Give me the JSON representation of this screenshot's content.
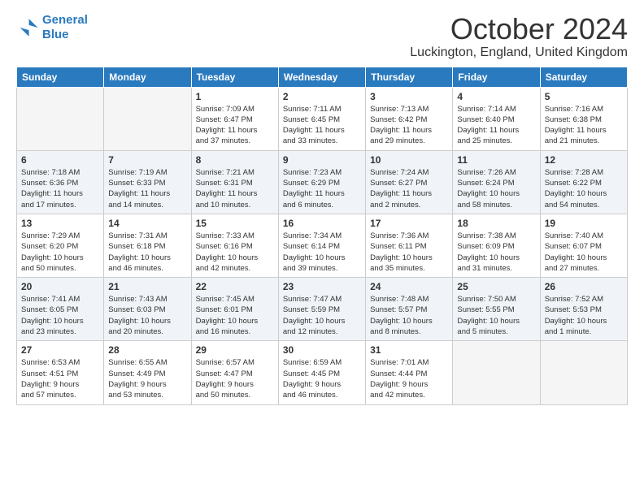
{
  "logo": {
    "line1": "General",
    "line2": "Blue"
  },
  "title": "October 2024",
  "location": "Luckington, England, United Kingdom",
  "days_of_week": [
    "Sunday",
    "Monday",
    "Tuesday",
    "Wednesday",
    "Thursday",
    "Friday",
    "Saturday"
  ],
  "weeks": [
    [
      {
        "num": "",
        "info": ""
      },
      {
        "num": "",
        "info": ""
      },
      {
        "num": "1",
        "info": "Sunrise: 7:09 AM\nSunset: 6:47 PM\nDaylight: 11 hours\nand 37 minutes."
      },
      {
        "num": "2",
        "info": "Sunrise: 7:11 AM\nSunset: 6:45 PM\nDaylight: 11 hours\nand 33 minutes."
      },
      {
        "num": "3",
        "info": "Sunrise: 7:13 AM\nSunset: 6:42 PM\nDaylight: 11 hours\nand 29 minutes."
      },
      {
        "num": "4",
        "info": "Sunrise: 7:14 AM\nSunset: 6:40 PM\nDaylight: 11 hours\nand 25 minutes."
      },
      {
        "num": "5",
        "info": "Sunrise: 7:16 AM\nSunset: 6:38 PM\nDaylight: 11 hours\nand 21 minutes."
      }
    ],
    [
      {
        "num": "6",
        "info": "Sunrise: 7:18 AM\nSunset: 6:36 PM\nDaylight: 11 hours\nand 17 minutes."
      },
      {
        "num": "7",
        "info": "Sunrise: 7:19 AM\nSunset: 6:33 PM\nDaylight: 11 hours\nand 14 minutes."
      },
      {
        "num": "8",
        "info": "Sunrise: 7:21 AM\nSunset: 6:31 PM\nDaylight: 11 hours\nand 10 minutes."
      },
      {
        "num": "9",
        "info": "Sunrise: 7:23 AM\nSunset: 6:29 PM\nDaylight: 11 hours\nand 6 minutes."
      },
      {
        "num": "10",
        "info": "Sunrise: 7:24 AM\nSunset: 6:27 PM\nDaylight: 11 hours\nand 2 minutes."
      },
      {
        "num": "11",
        "info": "Sunrise: 7:26 AM\nSunset: 6:24 PM\nDaylight: 10 hours\nand 58 minutes."
      },
      {
        "num": "12",
        "info": "Sunrise: 7:28 AM\nSunset: 6:22 PM\nDaylight: 10 hours\nand 54 minutes."
      }
    ],
    [
      {
        "num": "13",
        "info": "Sunrise: 7:29 AM\nSunset: 6:20 PM\nDaylight: 10 hours\nand 50 minutes."
      },
      {
        "num": "14",
        "info": "Sunrise: 7:31 AM\nSunset: 6:18 PM\nDaylight: 10 hours\nand 46 minutes."
      },
      {
        "num": "15",
        "info": "Sunrise: 7:33 AM\nSunset: 6:16 PM\nDaylight: 10 hours\nand 42 minutes."
      },
      {
        "num": "16",
        "info": "Sunrise: 7:34 AM\nSunset: 6:14 PM\nDaylight: 10 hours\nand 39 minutes."
      },
      {
        "num": "17",
        "info": "Sunrise: 7:36 AM\nSunset: 6:11 PM\nDaylight: 10 hours\nand 35 minutes."
      },
      {
        "num": "18",
        "info": "Sunrise: 7:38 AM\nSunset: 6:09 PM\nDaylight: 10 hours\nand 31 minutes."
      },
      {
        "num": "19",
        "info": "Sunrise: 7:40 AM\nSunset: 6:07 PM\nDaylight: 10 hours\nand 27 minutes."
      }
    ],
    [
      {
        "num": "20",
        "info": "Sunrise: 7:41 AM\nSunset: 6:05 PM\nDaylight: 10 hours\nand 23 minutes."
      },
      {
        "num": "21",
        "info": "Sunrise: 7:43 AM\nSunset: 6:03 PM\nDaylight: 10 hours\nand 20 minutes."
      },
      {
        "num": "22",
        "info": "Sunrise: 7:45 AM\nSunset: 6:01 PM\nDaylight: 10 hours\nand 16 minutes."
      },
      {
        "num": "23",
        "info": "Sunrise: 7:47 AM\nSunset: 5:59 PM\nDaylight: 10 hours\nand 12 minutes."
      },
      {
        "num": "24",
        "info": "Sunrise: 7:48 AM\nSunset: 5:57 PM\nDaylight: 10 hours\nand 8 minutes."
      },
      {
        "num": "25",
        "info": "Sunrise: 7:50 AM\nSunset: 5:55 PM\nDaylight: 10 hours\nand 5 minutes."
      },
      {
        "num": "26",
        "info": "Sunrise: 7:52 AM\nSunset: 5:53 PM\nDaylight: 10 hours\nand 1 minute."
      }
    ],
    [
      {
        "num": "27",
        "info": "Sunrise: 6:53 AM\nSunset: 4:51 PM\nDaylight: 9 hours\nand 57 minutes."
      },
      {
        "num": "28",
        "info": "Sunrise: 6:55 AM\nSunset: 4:49 PM\nDaylight: 9 hours\nand 53 minutes."
      },
      {
        "num": "29",
        "info": "Sunrise: 6:57 AM\nSunset: 4:47 PM\nDaylight: 9 hours\nand 50 minutes."
      },
      {
        "num": "30",
        "info": "Sunrise: 6:59 AM\nSunset: 4:45 PM\nDaylight: 9 hours\nand 46 minutes."
      },
      {
        "num": "31",
        "info": "Sunrise: 7:01 AM\nSunset: 4:44 PM\nDaylight: 9 hours\nand 42 minutes."
      },
      {
        "num": "",
        "info": ""
      },
      {
        "num": "",
        "info": ""
      }
    ]
  ]
}
